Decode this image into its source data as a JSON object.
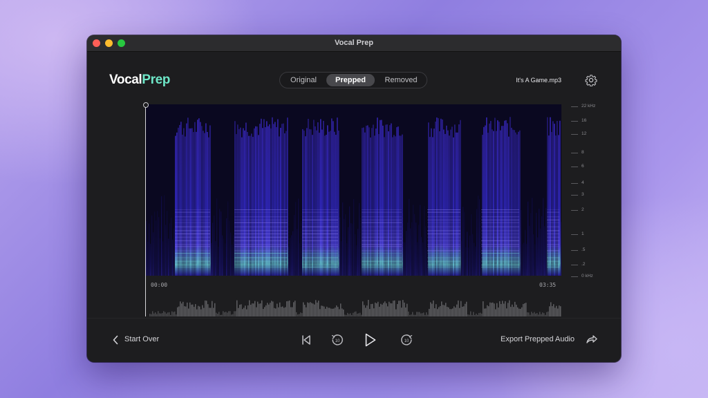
{
  "window": {
    "title": "Vocal Prep"
  },
  "brand": {
    "name_part1": "Vocal",
    "name_part2": "Prep",
    "accent_color": "#6ee7c8"
  },
  "view_tabs": [
    {
      "label": "Original",
      "selected": false
    },
    {
      "label": "Prepped",
      "selected": true
    },
    {
      "label": "Removed",
      "selected": false
    }
  ],
  "file": {
    "name": "It's A Game.mp3"
  },
  "icons": {
    "settings": "gear-icon",
    "back": "chevron-left-icon",
    "skip_start": "skip-to-start-icon",
    "rewind": "rewind-10-icon",
    "play": "play-icon",
    "forward": "forward-10-icon",
    "export": "share-arrow-icon"
  },
  "spectrogram": {
    "time_start": "00:00",
    "time_end": "03:35",
    "freq_labels": [
      "22 kHz",
      "16",
      "12",
      "8",
      "6",
      "4",
      "3",
      "2",
      "1",
      ".5",
      ".2",
      "0 kHz"
    ]
  },
  "footer": {
    "start_over_label": "Start Over",
    "rewind_seconds": "10",
    "forward_seconds": "10",
    "export_label": "Export Prepped Audio"
  },
  "colors": {
    "window_bg": "#1d1d1f",
    "spectrogram_low": "#2a1bd6",
    "spectrogram_high": "#7ff0e0",
    "close": "#ff5f57",
    "minimize": "#febc2e",
    "maximize": "#28c840"
  }
}
